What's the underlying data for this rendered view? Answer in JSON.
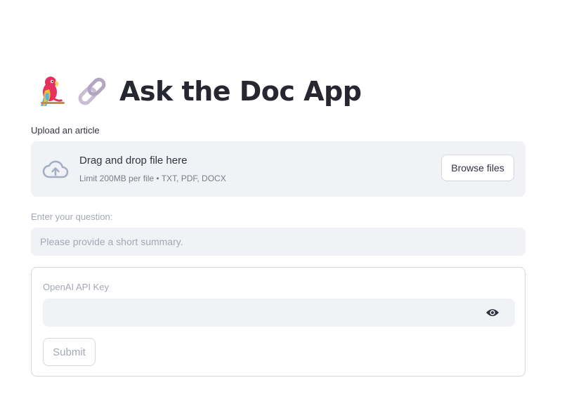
{
  "header": {
    "title": "Ask the Doc App",
    "icons": [
      "parrot-emoji",
      "link-emoji"
    ]
  },
  "uploader": {
    "label": "Upload an article",
    "dropzone_title": "Drag and drop file here",
    "dropzone_hint": "Limit 200MB per file • TXT, PDF, DOCX",
    "browse_label": "Browse files",
    "icon": "cloud-upload-icon"
  },
  "question": {
    "label": "Enter your question:",
    "placeholder": "Please provide a short summary."
  },
  "form": {
    "api_key_label": "OpenAI API Key",
    "api_key_value": "",
    "visibility_icon": "eye-icon",
    "submit_label": "Submit"
  },
  "colors": {
    "input_bg": "#f0f2f6",
    "text": "#31333f",
    "muted": "#a3a8b4",
    "border": "#d6d8dd"
  }
}
